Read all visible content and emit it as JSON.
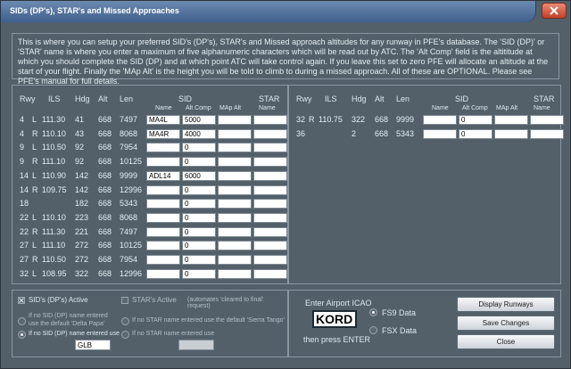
{
  "window": {
    "title": "SIDs (DP's), STAR's and Missed Approaches"
  },
  "description": "This is where you can setup your preferred SID's (DP's), STAR's and Missed approach altitudes for any runway in PFE's database. The 'SID (DP)' or 'STAR' name is where you enter a maximum of five alphanumeric characters which will be read out by ATC. The 'Alt Comp' field is the altititude at which you should complete the SID (DP) and at which point ATC will take control again. If you leave this set to zero PFE will allocate an altitude at the start of your flight. Finally the 'MAp Alt' is the height you will be told to climb to during a missed approach. All of these are OPTIONAL. Please see PFE's manual for full details.",
  "columns": {
    "rwy": "Rwy",
    "ils": "ILS",
    "hdg": "Hdg",
    "alt": "Alt",
    "len": "Len",
    "sid": "SID",
    "star": "STAR",
    "name": "Name",
    "alt_comp": "Alt Comp",
    "map_alt": "MAp Alt",
    "star_name": "Name"
  },
  "left_runways": [
    {
      "num": "4",
      "side": "L",
      "ils": "111.30",
      "hdg": "41",
      "alt": "668",
      "len": "7497",
      "sid_name": "MA4L",
      "alt_comp": "5000",
      "map_alt": "",
      "star": ""
    },
    {
      "num": "4",
      "side": "R",
      "ils": "110.10",
      "hdg": "43",
      "alt": "668",
      "len": "8068",
      "sid_name": "MA4R",
      "alt_comp": "4000",
      "map_alt": "",
      "star": ""
    },
    {
      "num": "9",
      "side": "L",
      "ils": "110.50",
      "hdg": "92",
      "alt": "668",
      "len": "7954",
      "sid_name": "",
      "alt_comp": "0",
      "map_alt": "",
      "star": ""
    },
    {
      "num": "9",
      "side": "R",
      "ils": "111.10",
      "hdg": "92",
      "alt": "668",
      "len": "10125",
      "sid_name": "",
      "alt_comp": "0",
      "map_alt": "",
      "star": ""
    },
    {
      "num": "14",
      "side": "L",
      "ils": "110.90",
      "hdg": "142",
      "alt": "668",
      "len": "9999",
      "sid_name": "ADL14",
      "alt_comp": "6000",
      "map_alt": "",
      "star": ""
    },
    {
      "num": "14",
      "side": "R",
      "ils": "109.75",
      "hdg": "142",
      "alt": "668",
      "len": "12996",
      "sid_name": "",
      "alt_comp": "0",
      "map_alt": "",
      "star": ""
    },
    {
      "num": "18",
      "side": "",
      "ils": "",
      "hdg": "182",
      "alt": "668",
      "len": "5343",
      "sid_name": "",
      "alt_comp": "0",
      "map_alt": "",
      "star": ""
    },
    {
      "num": "22",
      "side": "L",
      "ils": "110.10",
      "hdg": "223",
      "alt": "668",
      "len": "8068",
      "sid_name": "",
      "alt_comp": "0",
      "map_alt": "",
      "star": ""
    },
    {
      "num": "22",
      "side": "R",
      "ils": "111.30",
      "hdg": "221",
      "alt": "668",
      "len": "7497",
      "sid_name": "",
      "alt_comp": "0",
      "map_alt": "",
      "star": ""
    },
    {
      "num": "27",
      "side": "L",
      "ils": "111.10",
      "hdg": "272",
      "alt": "668",
      "len": "10125",
      "sid_name": "",
      "alt_comp": "0",
      "map_alt": "",
      "star": ""
    },
    {
      "num": "27",
      "side": "R",
      "ils": "110.50",
      "hdg": "272",
      "alt": "668",
      "len": "7954",
      "sid_name": "",
      "alt_comp": "0",
      "map_alt": "",
      "star": ""
    },
    {
      "num": "32",
      "side": "L",
      "ils": "108.95",
      "hdg": "322",
      "alt": "668",
      "len": "12996",
      "sid_name": "",
      "alt_comp": "0",
      "map_alt": "",
      "star": ""
    }
  ],
  "right_runways": [
    {
      "num": "32",
      "side": "R",
      "ils": "110.75",
      "hdg": "322",
      "alt": "668",
      "len": "9999",
      "sid_name": "",
      "alt_comp": "0",
      "map_alt": "",
      "star": ""
    },
    {
      "num": "36",
      "side": "",
      "ils": "",
      "hdg": "2",
      "alt": "668",
      "len": "5343",
      "sid_name": "",
      "alt_comp": "0",
      "map_alt": "",
      "star": ""
    }
  ],
  "sid_options": {
    "active_label": "SID's (DP's) Active",
    "default_label_1": "If no SID (DP) name entered",
    "default_label_2": "use the default 'Delta Papa'",
    "entered_label": "If no SID (DP) name entered use",
    "entered_value": "GLB"
  },
  "star_options": {
    "active_label": "STAR's Active",
    "active_note": "(automates 'cleared to final' request)",
    "default_label": "If no STAR name entered use the default 'Sierra Tango'",
    "entered_label": "If no STAR name entered use",
    "entered_value": ""
  },
  "airport": {
    "label": "Enter Airport ICAO",
    "value": "KORD",
    "hint": "then press ENTER",
    "fs9_label": "FS9 Data",
    "fsx_label": "FSX Data"
  },
  "buttons": {
    "display_runways": "Display Runways",
    "save_changes": "Save Changes",
    "close": "Close"
  }
}
